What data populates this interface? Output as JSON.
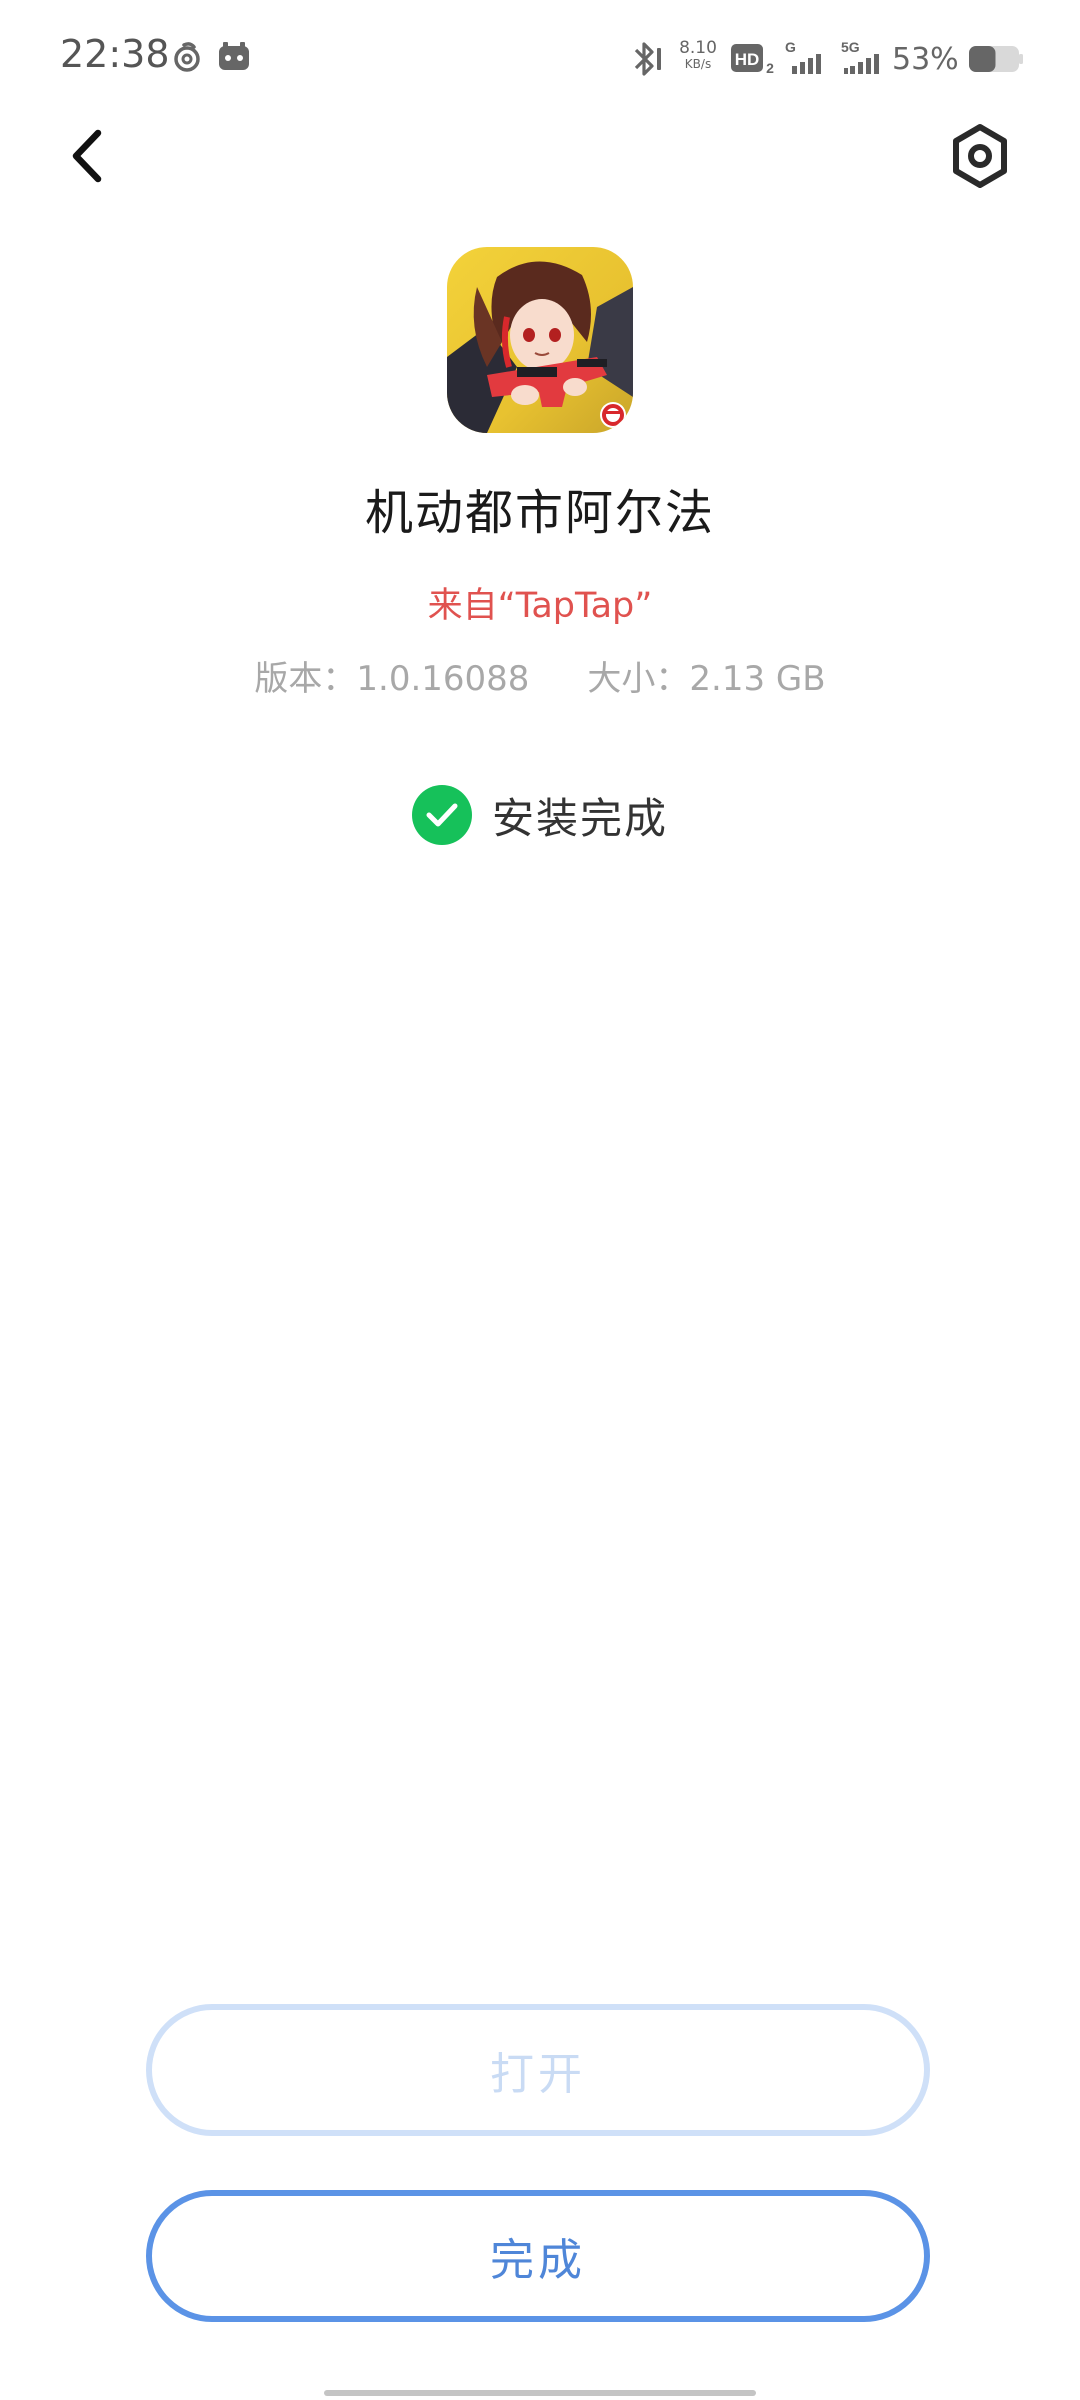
{
  "status_bar": {
    "time": "22:38",
    "net_speed_value": "8.10",
    "net_speed_unit": "KB/s",
    "hd_label": "HD",
    "hd_sub": "2",
    "signal1_label": "G",
    "signal2_label": "5G",
    "battery_percent": "53%",
    "battery_level": 0.53,
    "icons": [
      "netease-cloud-music-icon",
      "game-controller-icon",
      "bluetooth-icon",
      "hd-voice-icon",
      "signal-icon",
      "signal-5g-icon",
      "battery-icon"
    ]
  },
  "nav": {
    "back_icon": "chevron-left-icon",
    "settings_icon": "hexagon-settings-icon"
  },
  "app": {
    "name": "机动都市阿尔法",
    "source": "来自“TapTap”",
    "version": "版本：1.0.16088",
    "size": "大小：2.13 GB"
  },
  "install": {
    "status_text": "安装完成",
    "status_color": "#16c15a"
  },
  "buttons": {
    "open_label": "打开",
    "done_label": "完成"
  },
  "colors": {
    "source_red": "#e0524f",
    "accent_blue": "#5b93e6",
    "disabled_blue": "#cfe0f8"
  }
}
